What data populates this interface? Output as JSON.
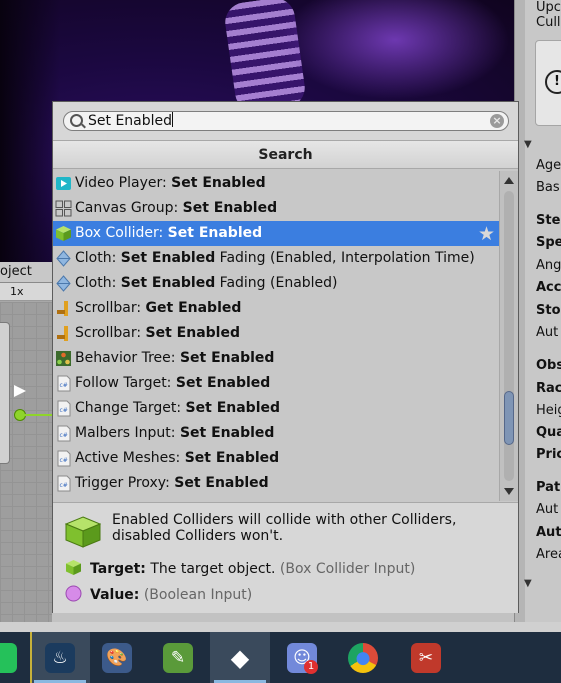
{
  "scene": {
    "label": "scene-view"
  },
  "graph": {
    "tab_label": "oject",
    "zoom_label": "1x"
  },
  "inspector": {
    "lines": [
      {
        "text": "Upc",
        "bold": false
      },
      {
        "text": "Cull",
        "bold": false
      },
      {
        "text": "Age",
        "bold": false
      },
      {
        "text": "Bas",
        "bold": false
      },
      {
        "text": "Ste",
        "bold": true
      },
      {
        "text": "Spe",
        "bold": true
      },
      {
        "text": "Ang",
        "bold": false
      },
      {
        "text": "Acc",
        "bold": true
      },
      {
        "text": "Sto",
        "bold": true
      },
      {
        "text": "Aut",
        "bold": false
      },
      {
        "text": "Obs",
        "bold": true
      },
      {
        "text": "Rac",
        "bold": true
      },
      {
        "text": "Heig",
        "bold": false
      },
      {
        "text": "Qua",
        "bold": true
      },
      {
        "text": "Pric",
        "bold": true
      },
      {
        "text": "Pat",
        "bold": true
      },
      {
        "text": "Aut",
        "bold": false
      },
      {
        "text": "Aut",
        "bold": true
      },
      {
        "text": "Area",
        "bold": false
      }
    ],
    "warning_glyph": "!"
  },
  "search": {
    "value": "Set Enabled",
    "clear_glyph": "×"
  },
  "list_header": "Search",
  "results": [
    {
      "component": "Video Player:",
      "method": "Set Enabled",
      "suffix": "",
      "icon": "video-player-icon",
      "selected": false
    },
    {
      "component": "Canvas Group:",
      "method": "Set Enabled",
      "suffix": "",
      "icon": "canvas-group-icon",
      "selected": false
    },
    {
      "component": "Box Collider:",
      "method": "Set Enabled",
      "suffix": "",
      "icon": "box-collider-icon",
      "selected": true
    },
    {
      "component": "Cloth:",
      "method": "Set Enabled",
      "suffix": " Fading (Enabled, Interpolation Time)",
      "icon": "cloth-icon",
      "selected": false
    },
    {
      "component": "Cloth:",
      "method": "Set Enabled",
      "suffix": " Fading (Enabled)",
      "icon": "cloth-icon",
      "selected": false
    },
    {
      "component": "Scrollbar:",
      "method": "Get Enabled",
      "suffix": "",
      "icon": "scrollbar-icon",
      "selected": false
    },
    {
      "component": "Scrollbar:",
      "method": "Set Enabled",
      "suffix": "",
      "icon": "scrollbar-icon",
      "selected": false
    },
    {
      "component": "Behavior Tree:",
      "method": "Set Enabled",
      "suffix": "",
      "icon": "behavior-tree-icon",
      "selected": false
    },
    {
      "component": "Follow Target:",
      "method": "Set Enabled",
      "suffix": "",
      "icon": "script-icon",
      "selected": false
    },
    {
      "component": "Change Target:",
      "method": "Set Enabled",
      "suffix": "",
      "icon": "script-icon",
      "selected": false
    },
    {
      "component": "Malbers Input:",
      "method": "Set Enabled",
      "suffix": "",
      "icon": "script-icon",
      "selected": false
    },
    {
      "component": "Active Meshes:",
      "method": "Set Enabled",
      "suffix": "",
      "icon": "script-icon",
      "selected": false
    },
    {
      "component": "Trigger Proxy:",
      "method": "Set Enabled",
      "suffix": "",
      "icon": "script-icon",
      "selected": false
    }
  ],
  "favorite_glyph": "★",
  "info": {
    "description": "Enabled Colliders will collide with other Colliders, disabled Colliders won't.",
    "params": [
      {
        "name": "Target:",
        "desc": "The target object.",
        "type": "(Box Collider Input)",
        "icon": "box-collider-icon"
      },
      {
        "name": "Value:",
        "desc": "",
        "type": "(Boolean Input)",
        "icon": "boolean-icon"
      }
    ]
  },
  "taskbar": {
    "items": [
      {
        "name": "whatsapp-icon",
        "glyph": "",
        "color": "#25c15a",
        "active": false
      },
      {
        "name": "steam-icon",
        "glyph": "♨",
        "color": "#1b3b5e",
        "active": true
      },
      {
        "name": "paint-icon",
        "glyph": "🎨",
        "color": "#3c5a8a",
        "active": false
      },
      {
        "name": "notepad-plus-icon",
        "glyph": "✎",
        "color": "#5a9a3a",
        "active": false
      },
      {
        "name": "unity-icon",
        "glyph": "◆",
        "color": "#ffffff",
        "active": true
      },
      {
        "name": "discord-icon",
        "glyph": "☺",
        "color": "#7289da",
        "active": false,
        "badge": "1"
      },
      {
        "name": "chrome-icon",
        "glyph": "●",
        "color": "#dd4b39",
        "active": false
      },
      {
        "name": "snipping-icon",
        "glyph": "✂",
        "color": "#c0392b",
        "active": false
      }
    ]
  },
  "colors": {
    "selection": "#3b7ee0",
    "accent_green": "#8fd42a"
  }
}
